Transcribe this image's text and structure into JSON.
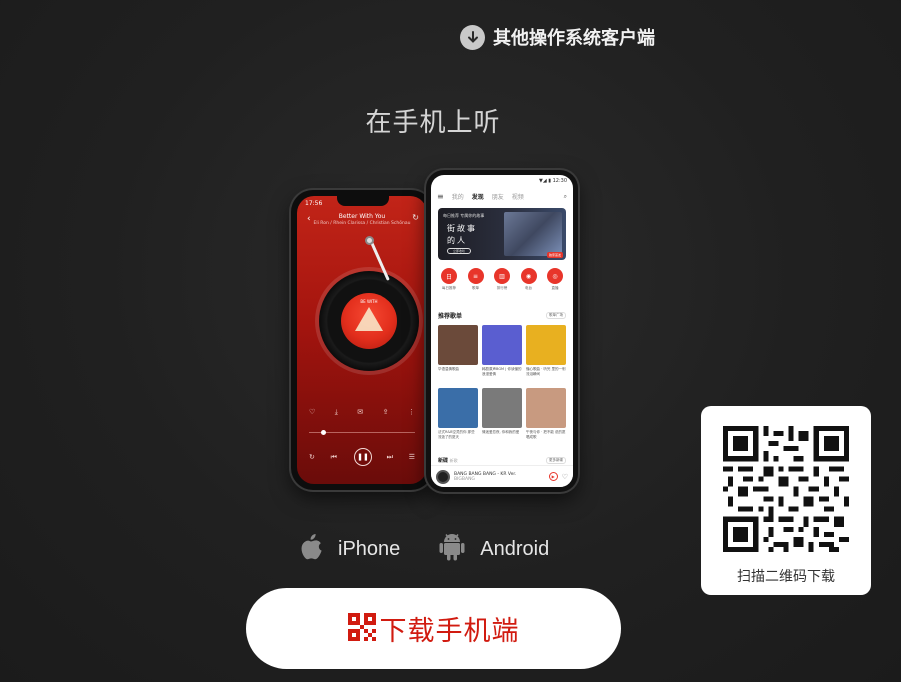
{
  "top_link": {
    "label": "其他操作系统客户端",
    "icon": "download-circle-icon"
  },
  "heading": "在手机上听",
  "ios_phone": {
    "status_time": "17:56",
    "song_title": "Better With You",
    "artist": "Eli Ron / Rhein Clarissa / Christian Schönau",
    "record_label": "BE WITH"
  },
  "android_phone": {
    "status": "▼◢ ▮ 12:30",
    "nav": {
      "tabs": [
        "我的",
        "发现",
        "朋友",
        "视频"
      ],
      "active": "发现"
    },
    "banner": {
      "small": "每日推荐 专属你的故事",
      "line1": "街故事",
      "line2": "的人",
      "button": "立即收听",
      "tag": "独家首发"
    },
    "icons": [
      {
        "label": "每日推荐",
        "glyph": "日"
      },
      {
        "label": "歌单",
        "glyph": "≡"
      },
      {
        "label": "排行榜",
        "glyph": "▥"
      },
      {
        "label": "电台",
        "glyph": "◉"
      },
      {
        "label": "直播",
        "glyph": "◎"
      }
    ],
    "rec_section": {
      "title": "推荐歌单",
      "more": "歌单广场"
    },
    "playlists_row1": [
      {
        "caption": "华语温情歌曲",
        "color": "#6b4a3a"
      },
      {
        "caption": "韩剧原声BGM | 你读懂的浪漫爱情",
        "color": "#5a5ed0"
      },
      {
        "caption": "懂心歌曲 · 听完 里的一剎流泪瞬间",
        "color": "#e8b020"
      }
    ],
    "playlists_row2": [
      {
        "caption": "法式R&B空灵的你 那些流逝了的夏天",
        "color": "#3a6ea8"
      },
      {
        "caption": "情迷爱恋夜, 你和我的爱",
        "color": "#7a7a7a"
      },
      {
        "caption": "午夜与你 · 把不能 说的愿 唱成歌",
        "color": "#c89a80"
      }
    ],
    "new_section": {
      "title": "新碟",
      "sub": "新歌",
      "more": "更多新碟"
    },
    "now_playing": {
      "title": "BANG BANG BANG - KR Ver.",
      "artist": "BIGBANG"
    }
  },
  "platforms": [
    {
      "name": "iPhone",
      "icon": "apple-icon"
    },
    {
      "name": "Android",
      "icon": "android-icon"
    }
  ],
  "download_button": {
    "label": "下载手机端",
    "icon": "qr-code-icon"
  },
  "qr_card": {
    "caption": "扫描二维码下载"
  },
  "colors": {
    "accent_red": "#d11b10",
    "background": "#222222"
  }
}
